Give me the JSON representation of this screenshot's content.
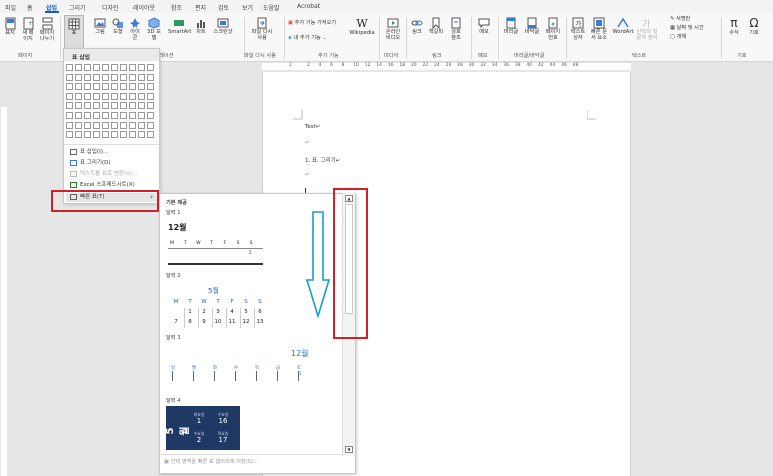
{
  "tabs": [
    "파일",
    "홈",
    "삽입",
    "그리기",
    "디자인",
    "레이아웃",
    "참조",
    "편지",
    "검토",
    "보기",
    "도움말",
    "Acrobat"
  ],
  "active_tab": "삽입",
  "ribbon": {
    "page_group": {
      "buttons": [
        "표지",
        "새 페이지",
        "페이지 나누기"
      ],
      "label": "페이지"
    },
    "table_button": "표",
    "illustration_group": {
      "buttons": [
        "그림",
        "도형",
        "아이콘",
        "3D 모델",
        "SmartArt",
        "차트",
        "스크린샷"
      ],
      "label": "일러스트레이션"
    },
    "reuse_group": {
      "button": "파일 다시 사용",
      "label": "파일 다시 사용"
    },
    "addin_group": {
      "items": [
        "추가 기능 가져오기",
        "내 추가 기능"
      ],
      "wikipedia": "Wikipedia",
      "label": "추가 기능"
    },
    "media_group": {
      "button": "온라인 비디오",
      "label": "미디어"
    },
    "link_group": {
      "buttons": [
        "링크",
        "책갈피",
        "상호 참조"
      ],
      "label": "링크"
    },
    "comment_group": {
      "button": "메모",
      "label": "메모"
    },
    "header_group": {
      "buttons": [
        "머리글",
        "바닥글",
        "페이지 번호"
      ],
      "label": "머리글/바닥글"
    },
    "text_group": {
      "buttons": [
        "텍스트 상자",
        "빠른 문서 요소",
        "WordArt",
        "단락의 첫 문자 장식"
      ],
      "side_items": [
        "서명란",
        "날짜 및 시간",
        "개체"
      ],
      "label": "텍스트"
    },
    "symbol_group": {
      "buttons": [
        "수식",
        "기호"
      ],
      "label": "기호"
    }
  },
  "table_menu": {
    "title": "표 삽입",
    "items": [
      {
        "label": "표 삽입(I)...",
        "disabled": false
      },
      {
        "label": "표 그리기(D)",
        "disabled": false
      },
      {
        "label": "텍스트를 표로 변환(V)...",
        "disabled": true
      },
      {
        "label": "Excel 스프레드시트(X)",
        "disabled": false
      },
      {
        "label": "빠른 표(T)",
        "disabled": false
      }
    ],
    "arrow": "›"
  },
  "quick_tables": {
    "header": "기본 제공",
    "cal1": {
      "label": "달력 1",
      "month": "12월",
      "days": [
        "M",
        "T",
        "W",
        "T",
        "F",
        "S",
        "S"
      ],
      "first": "1"
    },
    "cal2": {
      "label": "달력 2",
      "month": "5월",
      "days": [
        "M",
        "T",
        "W",
        "T",
        "F",
        "S",
        "S"
      ],
      "row1": [
        "",
        "1",
        "2",
        "3",
        "4",
        "5",
        "6"
      ],
      "row2": [
        "7",
        "8",
        "9",
        "10",
        "11",
        "12",
        "13"
      ]
    },
    "cal3": {
      "label": "달력 3",
      "month": "12월",
      "days": [
        "일",
        "월",
        "화",
        "수",
        "목",
        "금",
        "토"
      ],
      "first": "1"
    },
    "cal4": {
      "label": "달력 4",
      "month": "5월",
      "cells": [
        [
          "화요일",
          "1"
        ],
        [
          "수요일",
          "16"
        ],
        [
          "수요일",
          "2"
        ],
        [
          "목요일",
          "17"
        ]
      ]
    },
    "footer": "선택 영역을 빠른 표 갤러리에 저장(S)..."
  },
  "document": {
    "lines": [
      "Test↵",
      "↵",
      "1. 표. 그리기↵",
      "↵"
    ]
  },
  "ruler_numbers": [
    "2",
    "2",
    "4",
    "6",
    "8",
    "10",
    "12",
    "14",
    "16",
    "18",
    "20",
    "22",
    "24",
    "26",
    "28",
    "30",
    "32",
    "34",
    "36",
    "38",
    "40",
    "42",
    "44",
    "46",
    "48"
  ],
  "colors": {
    "accent": "#185abd",
    "annotation": "#d0202a",
    "arrow": "#1a9ad6",
    "calendar_blue": "#1f3864"
  }
}
